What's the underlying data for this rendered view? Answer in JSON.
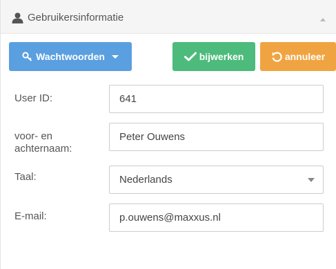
{
  "panel": {
    "title": "Gebruikersinformatie",
    "title_icon": "user-icon",
    "collapse_icon": "chevron-up-icon"
  },
  "toolbar": {
    "passwords_label": "Wachtwoorden",
    "passwords_icon": "key-icon",
    "update_label": "bijwerken",
    "update_icon": "check-icon",
    "cancel_label": "annuleer",
    "cancel_icon": "undo-icon"
  },
  "colors": {
    "blue": "#5a9fe0",
    "green": "#4cbb7b",
    "orange": "#f0a441"
  },
  "form": {
    "user_id": {
      "label": "User ID:",
      "value": "641"
    },
    "name": {
      "label_line1": "voor- en",
      "label_line2": "achternaam:",
      "value": "Peter Ouwens"
    },
    "language": {
      "label": "Taal:",
      "value": "Nederlands"
    },
    "email": {
      "label": "E-mail:",
      "value": "p.ouwens@maxxus.nl"
    }
  }
}
